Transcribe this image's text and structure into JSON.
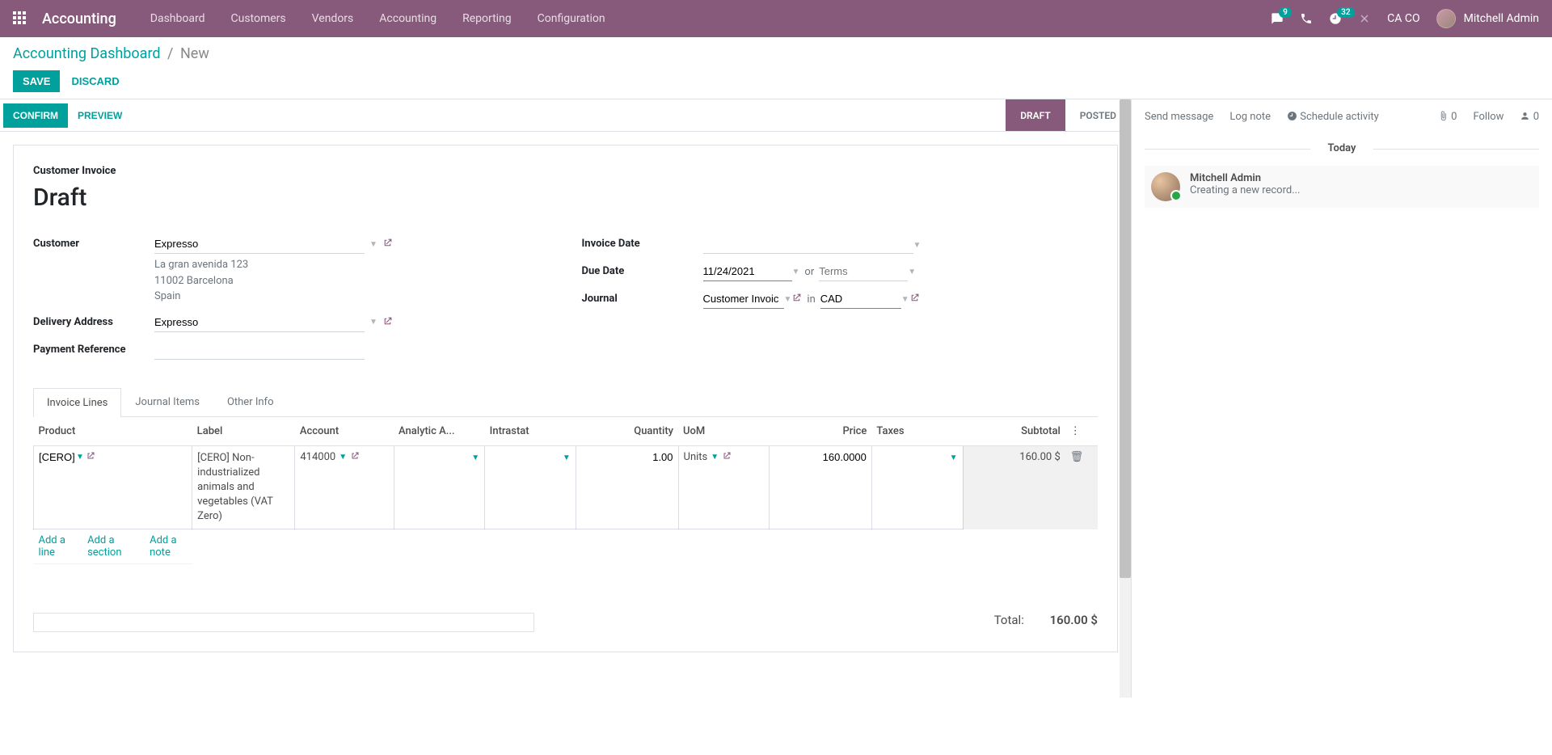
{
  "topbar": {
    "brand": "Accounting",
    "nav": [
      "Dashboard",
      "Customers",
      "Vendors",
      "Accounting",
      "Reporting",
      "Configuration"
    ],
    "msg_badge": "9",
    "activity_badge": "32",
    "company": "CA CO",
    "user": "Mitchell Admin"
  },
  "breadcrumb": {
    "root": "Accounting Dashboard",
    "current": "New"
  },
  "buttons": {
    "save": "SAVE",
    "discard": "DISCARD",
    "confirm": "CONFIRM",
    "preview": "PREVIEW"
  },
  "stages": {
    "draft": "DRAFT",
    "posted": "POSTED"
  },
  "form": {
    "doc_type": "Customer Invoice",
    "title": "Draft",
    "customer_label": "Customer",
    "customer": "Expresso",
    "address": {
      "street": "La gran avenida 123",
      "city": "11002 Barcelona",
      "country": "Spain"
    },
    "delivery_label": "Delivery Address",
    "delivery": "Expresso",
    "payment_ref_label": "Payment Reference",
    "invoice_date_label": "Invoice Date",
    "due_date_label": "Due Date",
    "due_date": "11/24/2021",
    "or": "or",
    "terms_placeholder": "Terms",
    "journal_label": "Journal",
    "journal": "Customer Invoic",
    "in": "in",
    "currency": "CAD"
  },
  "tabs": {
    "lines": "Invoice Lines",
    "items": "Journal Items",
    "other": "Other Info"
  },
  "table": {
    "headers": {
      "product": "Product",
      "label": "Label",
      "account": "Account",
      "analytic": "Analytic A...",
      "intrastat": "Intrastat",
      "quantity": "Quantity",
      "uom": "UoM",
      "price": "Price",
      "taxes": "Taxes",
      "subtotal": "Subtotal"
    },
    "row": {
      "product": "[CERO] N",
      "label": "[CERO] Non-industrialized animals and vegetables (VAT Zero)",
      "account": "414000",
      "quantity": "1.00",
      "uom": "Units",
      "price": "160.0000",
      "subtotal": "160.00 $"
    },
    "add_line": "Add a line",
    "add_section": "Add a section",
    "add_note": "Add a note"
  },
  "totals": {
    "label": "Total:",
    "value": "160.00 $"
  },
  "chatter": {
    "send": "Send message",
    "log": "Log note",
    "schedule": "Schedule activity",
    "attach_count": "0",
    "follow": "Follow",
    "follower_count": "0",
    "today": "Today",
    "msg_name": "Mitchell Admin",
    "msg_text": "Creating a new record..."
  }
}
